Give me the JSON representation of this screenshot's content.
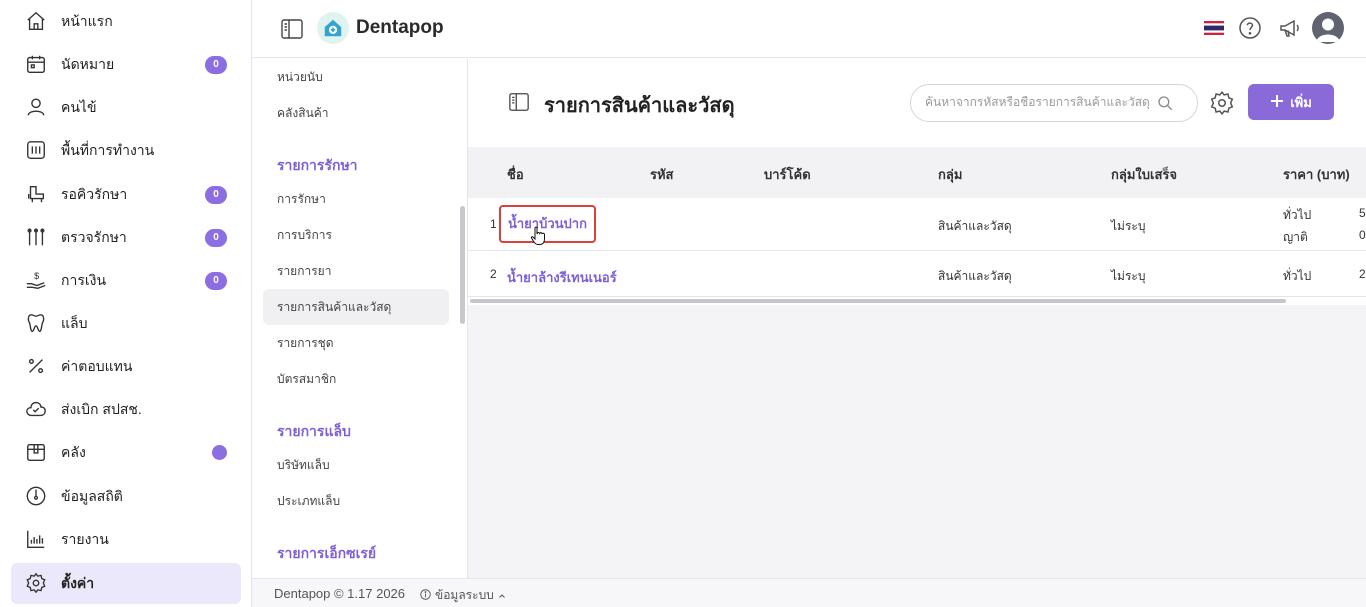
{
  "app": {
    "brand": "Dentapop"
  },
  "sidebar": {
    "items": [
      {
        "label": "หน้าแรก",
        "icon": "home-icon"
      },
      {
        "label": "นัดหมาย",
        "icon": "calendar-icon",
        "badge": "0"
      },
      {
        "label": "คนไข้",
        "icon": "user-icon"
      },
      {
        "label": "พื้นที่การทำงาน",
        "icon": "workspace-icon"
      },
      {
        "label": "รอคิวรักษา",
        "icon": "dental-chair-icon",
        "badge": "0"
      },
      {
        "label": "ตรวจรักษา",
        "icon": "dental-tools-icon",
        "badge": "0"
      },
      {
        "label": "การเงิน",
        "icon": "money-hand-icon",
        "badge": "0"
      },
      {
        "label": "แล็บ",
        "icon": "tooth-icon"
      },
      {
        "label": "ค่าตอบแทน",
        "icon": "percent-icon"
      },
      {
        "label": "ส่งเบิก สปสช.",
        "icon": "cloud-check-icon"
      },
      {
        "label": "คลัง",
        "icon": "box-icon",
        "dot": true
      },
      {
        "label": "ข้อมูลสถิติ",
        "icon": "gauge-icon"
      },
      {
        "label": "รายงาน",
        "icon": "report-chart-icon"
      },
      {
        "label": "ตั้งค่า",
        "icon": "gear-icon",
        "active": true
      }
    ]
  },
  "submenu": {
    "top_items": [
      "หน่วยนับ",
      "คลังสินค้า"
    ],
    "sections": [
      {
        "heading": "รายการรักษา",
        "items": [
          "การรักษา",
          "การบริการ",
          "รายการยา",
          "รายการสินค้าและวัสดุ",
          "รายการชุด",
          "บัตรสมาชิก"
        ]
      },
      {
        "heading": "รายการแล็บ",
        "items": [
          "บริษัทแล็บ",
          "ประเภทแล็บ"
        ]
      },
      {
        "heading": "รายการเอ็กซเรย์",
        "items": []
      }
    ]
  },
  "page": {
    "title": "รายการสินค้าและวัสดุ",
    "search_placeholder": "ค้นหาจากรหัสหรือชื่อรายการสินค้าและวัสดุ",
    "add_label": "เพิ่ม"
  },
  "table": {
    "columns": [
      "ชื่อ",
      "รหัส",
      "บาร์โค้ด",
      "กลุ่ม",
      "กลุ่มใบเสร็จ",
      "ราคา (บาท)"
    ],
    "rows": [
      {
        "index": "1",
        "name": "น้ำยาบ้วนปาก",
        "code": "",
        "barcode": "",
        "group": "สินค้าและวัสดุ",
        "receipt_group": "ไม่ระบุ",
        "prices": [
          {
            "label": "ทั่วไป",
            "value": "5"
          },
          {
            "label": "ญาติ",
            "value": "0"
          }
        ]
      },
      {
        "index": "2",
        "name": "น้ำยาล้างรีเทนเนอร์",
        "code": "",
        "barcode": "",
        "group": "สินค้าและวัสดุ",
        "receipt_group": "ไม่ระบุ",
        "prices": [
          {
            "label": "ทั่วไป",
            "value": "2"
          }
        ]
      }
    ]
  },
  "footer": {
    "copyright": "Dentapop © 1.17 2026",
    "sysinfo": "ข้อมูลระบบ"
  },
  "colors": {
    "accent": "#8a6ad9",
    "active_bg": "#ece8fb",
    "highlight_border": "#d9413f"
  }
}
